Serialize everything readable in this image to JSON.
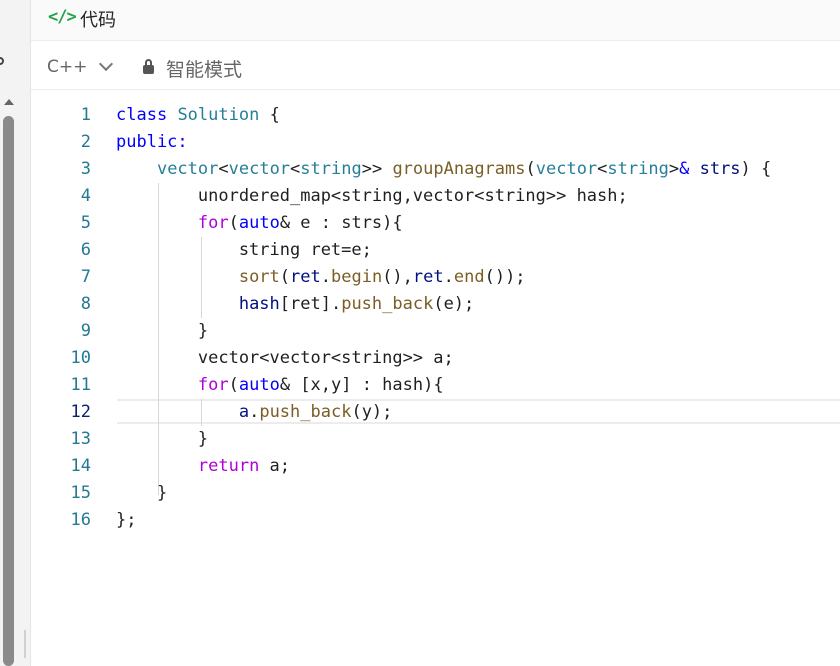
{
  "header": {
    "icon": "code-brackets-icon",
    "icon_glyph": "</>",
    "title": "代码"
  },
  "toolbar": {
    "language": "C++",
    "mode_label": "智能模式"
  },
  "colors": {
    "icon_green": "#1fa44a",
    "line_number": "#237893",
    "keyword_blue": "#0000ff",
    "keyword_purple": "#af00db",
    "type": "#267f99",
    "function": "#795e26",
    "variable": "#001080"
  },
  "editor": {
    "current_line": 12,
    "line_numbers": [
      "1",
      "2",
      "3",
      "4",
      "5",
      "6",
      "7",
      "8",
      "9",
      "10",
      "11",
      "12",
      "13",
      "14",
      "15",
      "16"
    ],
    "lines": [
      [
        {
          "t": "class",
          "c": "kw"
        },
        {
          "t": " ",
          "c": "pl"
        },
        {
          "t": "Solution",
          "c": "ty"
        },
        {
          "t": " {",
          "c": "pl"
        }
      ],
      [
        {
          "t": "public:",
          "c": "kw"
        }
      ],
      [
        {
          "t": "    ",
          "c": "pl"
        },
        {
          "t": "vector",
          "c": "ty"
        },
        {
          "t": "<",
          "c": "pl"
        },
        {
          "t": "vector",
          "c": "ty"
        },
        {
          "t": "<",
          "c": "pl"
        },
        {
          "t": "string",
          "c": "ty"
        },
        {
          "t": ">> ",
          "c": "pl"
        },
        {
          "t": "groupAnagrams",
          "c": "fn"
        },
        {
          "t": "(",
          "c": "pl"
        },
        {
          "t": "vector",
          "c": "ty"
        },
        {
          "t": "<",
          "c": "pl"
        },
        {
          "t": "string",
          "c": "ty"
        },
        {
          "t": ">",
          "c": "pl"
        },
        {
          "t": "&",
          "c": "kw"
        },
        {
          "t": " ",
          "c": "pl"
        },
        {
          "t": "strs",
          "c": "va"
        },
        {
          "t": ") {",
          "c": "pl"
        }
      ],
      [
        {
          "t": "        unordered_map<string,vector<string>> hash;",
          "c": "pl"
        }
      ],
      [
        {
          "t": "        ",
          "c": "pl"
        },
        {
          "t": "for",
          "c": "kw2"
        },
        {
          "t": "(",
          "c": "pl"
        },
        {
          "t": "auto",
          "c": "kw"
        },
        {
          "t": "& e : strs){",
          "c": "pl"
        }
      ],
      [
        {
          "t": "            string ret=e;",
          "c": "pl"
        }
      ],
      [
        {
          "t": "            ",
          "c": "pl"
        },
        {
          "t": "sort",
          "c": "fn"
        },
        {
          "t": "(",
          "c": "pl"
        },
        {
          "t": "ret",
          "c": "va"
        },
        {
          "t": ".",
          "c": "pl"
        },
        {
          "t": "begin",
          "c": "fn"
        },
        {
          "t": "(),",
          "c": "pl"
        },
        {
          "t": "ret",
          "c": "va"
        },
        {
          "t": ".",
          "c": "pl"
        },
        {
          "t": "end",
          "c": "fn"
        },
        {
          "t": "());",
          "c": "pl"
        }
      ],
      [
        {
          "t": "            ",
          "c": "pl"
        },
        {
          "t": "hash",
          "c": "va"
        },
        {
          "t": "[ret].",
          "c": "pl"
        },
        {
          "t": "push_back",
          "c": "fn"
        },
        {
          "t": "(e);",
          "c": "pl"
        }
      ],
      [
        {
          "t": "        }",
          "c": "pl"
        }
      ],
      [
        {
          "t": "        vector<vector<string>> a;",
          "c": "pl"
        }
      ],
      [
        {
          "t": "        ",
          "c": "pl"
        },
        {
          "t": "for",
          "c": "kw2"
        },
        {
          "t": "(",
          "c": "pl"
        },
        {
          "t": "auto",
          "c": "kw"
        },
        {
          "t": "& [x,y] : hash){",
          "c": "pl"
        }
      ],
      [
        {
          "t": "            ",
          "c": "pl"
        },
        {
          "t": "a",
          "c": "va"
        },
        {
          "t": ".",
          "c": "pl"
        },
        {
          "t": "push_back",
          "c": "fn"
        },
        {
          "t": "(y);",
          "c": "pl"
        }
      ],
      [
        {
          "t": "        }",
          "c": "pl"
        }
      ],
      [
        {
          "t": "        ",
          "c": "pl"
        },
        {
          "t": "return",
          "c": "kw2"
        },
        {
          "t": " a;",
          "c": "pl"
        }
      ],
      [
        {
          "t": "    }",
          "c": "pl"
        }
      ],
      [
        {
          "t": "};",
          "c": "pl"
        }
      ]
    ]
  }
}
